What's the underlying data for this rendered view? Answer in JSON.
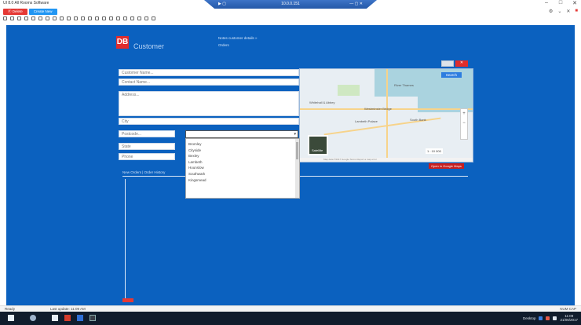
{
  "window": {
    "title": "UI 8.0 All Rooms Software",
    "controls": [
      "–",
      "□",
      "✕"
    ]
  },
  "actions": {
    "red_button": "Ⓟ Delete",
    "blue_button": "Create New"
  },
  "right_tools": [
    "⚙",
    "⌄",
    "✕",
    "■"
  ],
  "toolbar_icon_count": 22,
  "remote_bar": {
    "left": "▶ ▢",
    "center": "10.0.0.151",
    "right": "— ▢ ✕"
  },
  "app": {
    "logo": "DB",
    "title": "Customer",
    "links": [
      "Notes customer details »",
      "Orders"
    ]
  },
  "form": {
    "customer_name": "Customer Name...",
    "contact_name": "Contact Name...",
    "address": "Address...",
    "city": "City",
    "postcode": "Postcode...",
    "state": "State",
    "phone": "Phone",
    "dropdown_value": ""
  },
  "dropdown_options": [
    "Bromley",
    "Cityside",
    "Bexley",
    "Lambeth",
    "Hounslow",
    "Southwark",
    "Kingsmead"
  ],
  "tabs": "New Orders  |  Order History",
  "map": {
    "search_button": "Search",
    "satellite_label": "Satellite",
    "zoom_in": "+",
    "zoom_out": "−",
    "scale": "1 : 10 000",
    "labels": [
      "Whitehall & Abbey",
      "Westminster Bridge",
      "Lambeth Palace",
      "South Bank",
      "River Thames"
    ],
    "footer": "Map data ©2017 Google  Terms  Report a map error",
    "toggle_close": "✕",
    "link": "Open in Google Maps"
  },
  "statusbar": {
    "left": "Ready",
    "middle": "Last update: 11:09 AM",
    "right": "NUM  CAP"
  },
  "taskbar": {
    "tray_text": "Desktop",
    "time": "11:09",
    "date": "21/06/2017"
  },
  "colors": {
    "main_blue": "#0b61bf",
    "accent_red": "#e02c2c",
    "accent_blue": "#2196f3"
  }
}
